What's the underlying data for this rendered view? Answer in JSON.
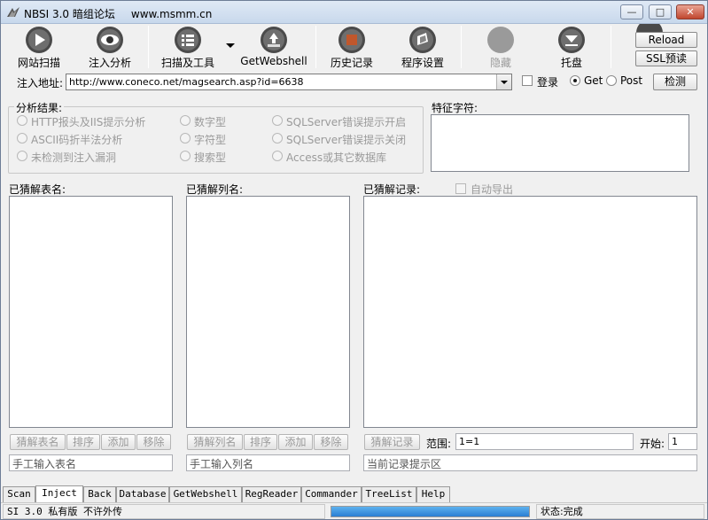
{
  "window": {
    "app_title": "NBSI 3.0 暗组论坛",
    "site": "www.msmm.cn",
    "min_glyph": "—",
    "max_glyph": "□",
    "close_glyph": "✕"
  },
  "toolbar": {
    "scan_site": "网站扫描",
    "inject_analysis": "注入分析",
    "scan_tools": "扫描及工具",
    "getwebshell": "GetWebshell",
    "history": "历史记录",
    "settings": "程序设置",
    "hide": "隐藏",
    "tray": "托盘",
    "reload": "Reload",
    "ssl": "SSL预读"
  },
  "url_row": {
    "label": "注入地址:",
    "url": "http://www.coneco.net/magsearch.asp?id=6638",
    "login_label": "登录",
    "get_label": "Get",
    "post_label": "Post",
    "detect_button": "检测",
    "method_selected": "Get"
  },
  "analysis": {
    "title": "分析结果:",
    "options": [
      "HTTP报头及IIS提示分析",
      "ASCII码折半法分析",
      "未检测到注入漏洞",
      "数字型",
      "字符型",
      "搜索型",
      "SQLServer错误提示开启",
      "SQLServer错误提示关闭",
      "Access或其它数据库"
    ]
  },
  "feature": {
    "title": "特征字符:"
  },
  "tables_panel": {
    "title": "已猜解表名:",
    "buttons": [
      "猜解表名",
      "排序",
      "添加",
      "移除"
    ],
    "input_placeholder": "手工输入表名"
  },
  "columns_panel": {
    "title": "已猜解列名:",
    "buttons": [
      "猜解列名",
      "排序",
      "添加",
      "移除"
    ],
    "input_placeholder": "手工输入列名"
  },
  "records_panel": {
    "title": "已猜解记录:",
    "auto_export": "自动导出",
    "guess_button": "猜解记录",
    "range_label": "范围:",
    "range_value": "1=1",
    "start_label": "开始:",
    "start_value": "1",
    "hint_placeholder": "当前记录提示区"
  },
  "tabs": [
    "Scan",
    "Inject",
    "Back",
    "Database",
    "GetWebshell",
    "RegReader",
    "Commander",
    "TreeList",
    "Help"
  ],
  "active_tab": "Inject",
  "status": {
    "version": "SI 3.0 私有版 不许外传",
    "state": "状态:完成",
    "progress": 1.0
  },
  "colors": {
    "accent": "#2a7ed3",
    "disabled_text": "#9a9a9a"
  }
}
